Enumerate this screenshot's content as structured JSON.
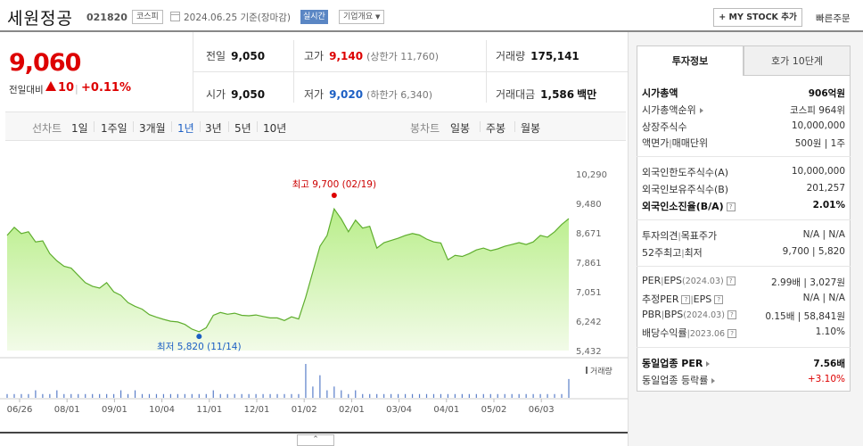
{
  "header": {
    "name": "세원정공",
    "code": "021820",
    "market": "코스피",
    "date": "2024.06.25 기준(장마감)",
    "realtime": "실시간",
    "company_info": "기업개요",
    "mystock": "+ MY STOCK 추가",
    "fast_order": "빠른주문"
  },
  "quote": {
    "price": "9,060",
    "change_label": "전일대비",
    "change": "10",
    "change_pct": "+0.11%",
    "prev_label": "전일",
    "prev": "9,050",
    "open_label": "시가",
    "open": "9,050",
    "high_label": "고가",
    "high": "9,140",
    "upper_limit": "(상한가 11,760)",
    "low_label": "저가",
    "low": "9,020",
    "lower_limit": "(하한가 6,340)",
    "volume_label": "거래량",
    "volume": "175,141",
    "amount_label": "거래대금",
    "amount": "1,586",
    "amount_unit": "백만"
  },
  "periods": {
    "line_label": "선차트",
    "line": [
      "1일",
      "1주일",
      "3개월",
      "1년",
      "3년",
      "5년",
      "10년"
    ],
    "selected": "1년",
    "candle_label": "봉차트",
    "candle": [
      "일봉",
      "주봉",
      "월봉"
    ]
  },
  "chart_data": {
    "type": "area",
    "ylim": [
      5432,
      10290
    ],
    "y_ticks": [
      "10,290",
      "9,480",
      "8,671",
      "7,861",
      "7,051",
      "6,242",
      "5,432"
    ],
    "x_ticks": [
      "06/26",
      "08/01",
      "09/01",
      "10/04",
      "11/01",
      "12/01",
      "01/02",
      "02/01",
      "03/04",
      "04/01",
      "05/02",
      "06/03"
    ],
    "volume_label": "거래량",
    "max_label": "최고 9,700 (02/19)",
    "min_label": "최저 5,820 (11/14)",
    "max_value": 9700,
    "min_value": 5820,
    "max_index": 46,
    "min_index": 27,
    "values": [
      8600,
      8820,
      8650,
      8700,
      8420,
      8450,
      8100,
      7900,
      7750,
      7700,
      7500,
      7300,
      7200,
      7150,
      7300,
      7050,
      6950,
      6750,
      6650,
      6570,
      6420,
      6350,
      6290,
      6240,
      6220,
      6150,
      6020,
      5950,
      6060,
      6400,
      6480,
      6430,
      6460,
      6400,
      6390,
      6410,
      6370,
      6330,
      6330,
      6260,
      6360,
      6300,
      6900,
      7600,
      8300,
      8600,
      9330,
      9050,
      8700,
      9020,
      8800,
      8850,
      8250,
      8400,
      8460,
      8520,
      8600,
      8650,
      8610,
      8500,
      8420,
      8390,
      7930,
      8050,
      8020,
      8100,
      8200,
      8250,
      8180,
      8230,
      8300,
      8350,
      8400,
      8350,
      8420,
      8600,
      8550,
      8700,
      8900,
      9060
    ],
    "volume": [
      1,
      1,
      1,
      1,
      2,
      1,
      1,
      2,
      1,
      1,
      1,
      1,
      1,
      1,
      1,
      1,
      2,
      1,
      2,
      1,
      1,
      1,
      1,
      1,
      1,
      1,
      1,
      1,
      1,
      2,
      1,
      1,
      1,
      1,
      1,
      1,
      1,
      1,
      1,
      1,
      1,
      1,
      9,
      3,
      6,
      2,
      3,
      2,
      1,
      2,
      1,
      1,
      1,
      1,
      1,
      1,
      1,
      1,
      1,
      1,
      1,
      1,
      1,
      1,
      1,
      1,
      1,
      1,
      1,
      1,
      1,
      1,
      1,
      1,
      1,
      1,
      1,
      1,
      1,
      5
    ]
  },
  "panel": {
    "tab_invest": "투자정보",
    "tab_orderbook": "호가 10단계",
    "market_cap_label": "시가총액",
    "market_cap": "906억원",
    "market_cap_rank_label": "시가총액순위",
    "market_cap_rank": "코스피 964위",
    "shares_label": "상장주식수",
    "shares": "10,000,000",
    "par_label": "액면가",
    "par_sep": "|",
    "unit_label": "매매단위",
    "par_unit": "500원 | 1주",
    "foreign_limit_label": "외국인한도주식수(A)",
    "foreign_limit": "10,000,000",
    "foreign_hold_label": "외국인보유주식수(B)",
    "foreign_hold": "201,257",
    "foreign_ratio_label": "외국인소진율(B/A)",
    "foreign_ratio": "2.01%",
    "opinion_label": "투자의견",
    "target_label": "목표주가",
    "opinion_target": "N/A | N/A",
    "w52_label": "52주최고",
    "w52_low_label": "최저",
    "w52": "9,700 | 5,820",
    "per_label": "PER",
    "eps_label": "EPS",
    "eps_period": "(2024.03)",
    "per_eps": "2.99배 | 3,027원",
    "est_per_label": "추정PER",
    "est_eps_label": "EPS",
    "est_per_eps": "N/A | N/A",
    "pbr_label": "PBR",
    "bps_label": "BPS",
    "bps_period": "(2024.03)",
    "pbr_bps": "0.15배 | 58,841원",
    "dividend_label": "배당수익률",
    "dividend_period": "2023.06",
    "dividend": "1.10%",
    "sector_per_label": "동일업종 PER",
    "sector_per": "7.56배",
    "sector_rate_label": "동일업종 등락률",
    "sector_rate": "+3.10%"
  }
}
